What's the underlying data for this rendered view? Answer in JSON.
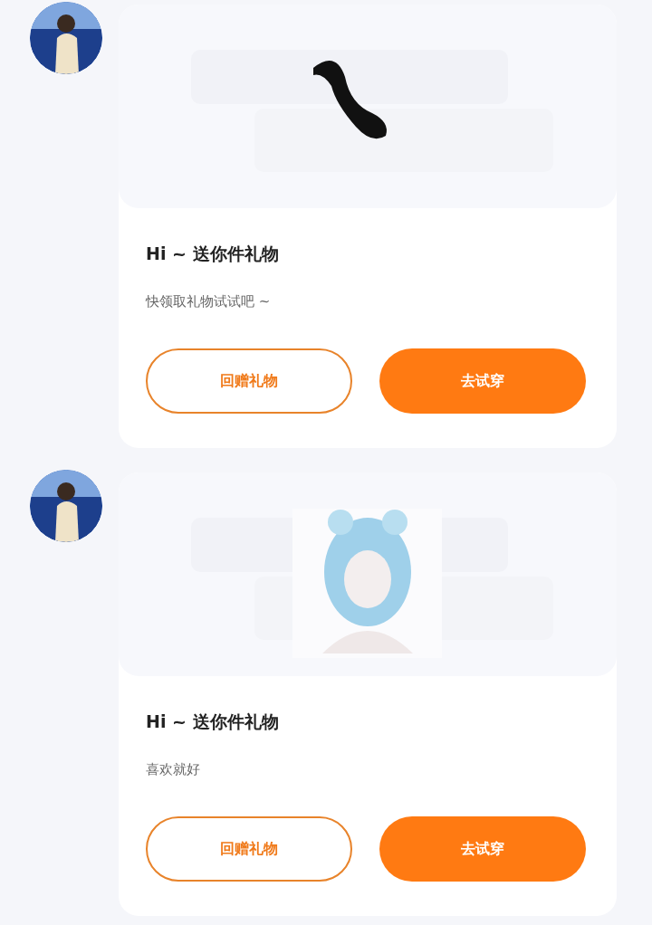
{
  "messages": [
    {
      "title": "Hi ~ 送你件礼物",
      "text": "快领取礼物试试吧 ~",
      "buttons": [
        {
          "label": "回赠礼物",
          "kind": "outline"
        },
        {
          "label": "去试穿",
          "kind": "filled"
        }
      ]
    },
    {
      "title": "Hi ~ 送你件礼物",
      "text": "喜欢就好",
      "buttons": [
        {
          "label": "回赠礼物",
          "kind": "outline"
        },
        {
          "label": "去试穿",
          "kind": "filled"
        }
      ]
    }
  ]
}
